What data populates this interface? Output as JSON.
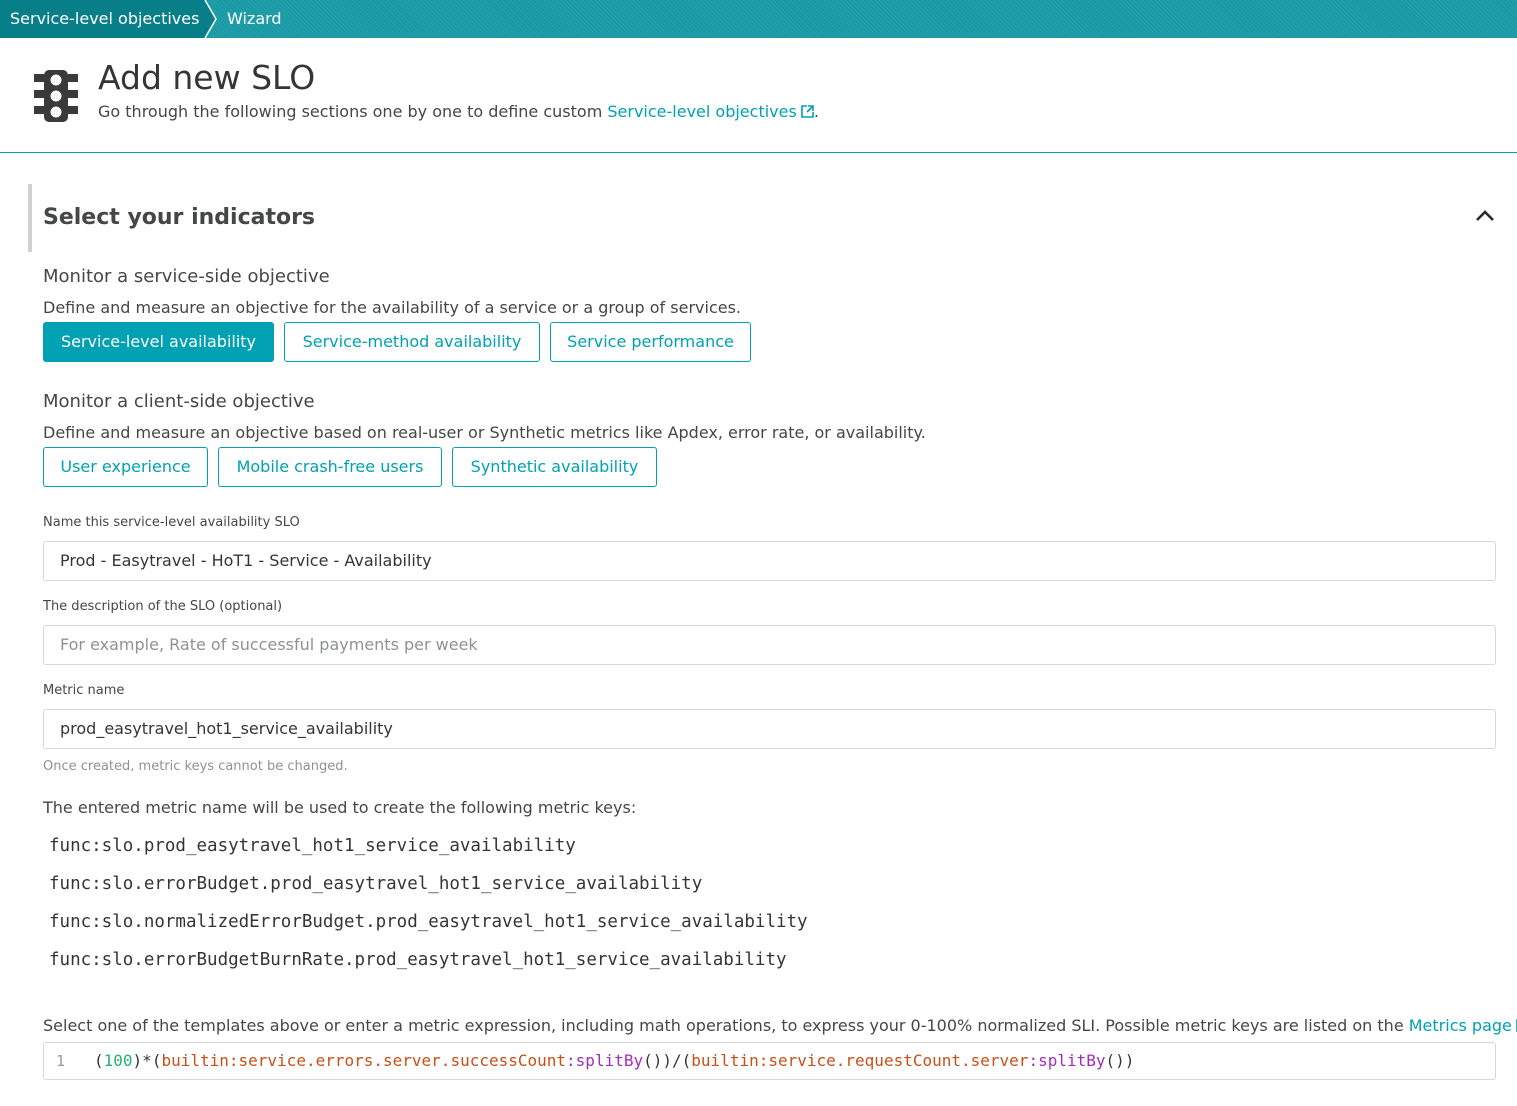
{
  "breadcrumb": {
    "items": [
      "Service-level objectives",
      "Wizard"
    ]
  },
  "header": {
    "title": "Add new SLO",
    "subtitle_prefix": "Go through the following sections one by one to define custom ",
    "subtitle_link": "Service-level objectives",
    "subtitle_suffix": ".",
    "icon": "traffic-light-icon"
  },
  "section": {
    "title": "Select your indicators",
    "collapse_icon": "chevron-up-icon"
  },
  "service_side": {
    "heading": "Monitor a service-side objective",
    "description": "Define and measure an objective for the availability of a service or a group of services.",
    "buttons": [
      "Service-level availability",
      "Service-method availability",
      "Service performance"
    ],
    "selected": "Service-level availability"
  },
  "client_side": {
    "heading": "Monitor a client-side objective",
    "description": "Define and measure an objective based on real-user or Synthetic metrics like Apdex, error rate, or availability.",
    "buttons": [
      "User experience",
      "Mobile crash-free users",
      "Synthetic availability"
    ]
  },
  "form": {
    "name_label": "Name this service-level availability SLO",
    "name_value": "Prod - Easytravel - HoT1 - Service - Availability",
    "description_label": "The description of the SLO (optional)",
    "description_placeholder": "For example, Rate of successful payments per week",
    "metric_label": "Metric name",
    "metric_value": "prod_easytravel_hot1_service_availability",
    "metric_hint": "Once created, metric keys cannot be changed."
  },
  "metric_keys": {
    "intro": "The entered metric name will be used to create the following metric keys:",
    "keys": [
      "func:slo.prod_easytravel_hot1_service_availability",
      "func:slo.errorBudget.prod_easytravel_hot1_service_availability",
      "func:slo.normalizedErrorBudget.prod_easytravel_hot1_service_availability",
      "func:slo.errorBudgetBurnRate.prod_easytravel_hot1_service_availability"
    ]
  },
  "expression": {
    "intro_prefix": "Select one of the templates above or enter a metric expression, including math operations, to express your 0-100% normalized SLI. Possible metric keys are listed on the ",
    "intro_link": "Metrics page",
    "intro_suffix": ".",
    "line_number": "1",
    "tokens": {
      "p1": "(",
      "n100": "100",
      "p2": ")*(",
      "key1": "builtin:service.errors.server.successCount",
      "c1": ":",
      "fn1": "splitBy",
      "p3": "())/(",
      "key2": "builtin:service.requestCount.server",
      "c2": ":",
      "fn2": "splitBy",
      "p4": "())"
    }
  },
  "colors": {
    "accent": "#00a1b2",
    "breadcrumb_bar": "#1a9aa5",
    "breadcrumb_active": "#087f88"
  }
}
